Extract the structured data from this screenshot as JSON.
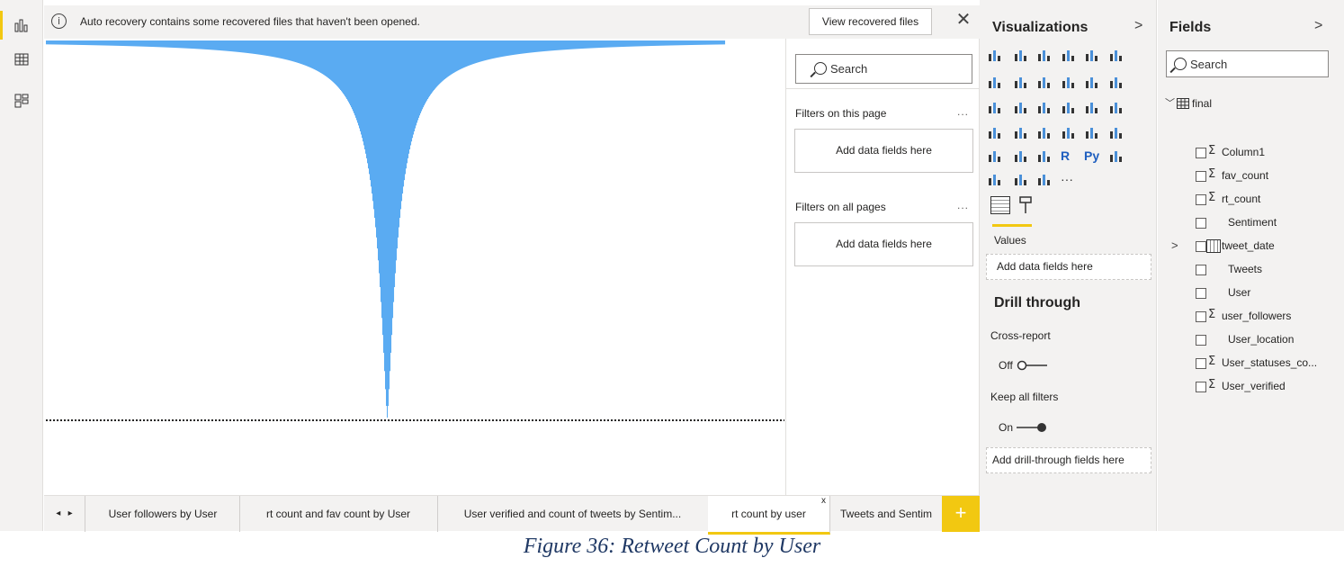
{
  "infobar": {
    "message": "Auto recovery contains some recovered files that haven't been opened.",
    "info_glyph": "i",
    "view_button": "View recovered files",
    "close_glyph": "✕"
  },
  "filters": {
    "search_placeholder": "Search",
    "page_title": "Filters on this page",
    "page_more": "...",
    "page_well": "Add data fields here",
    "all_title": "Filters on all pages",
    "all_more": "...",
    "all_well": "Add data fields here"
  },
  "visualizations": {
    "title": "Visualizations",
    "chevron": ">",
    "icon_R": "R",
    "icon_Py": "Py",
    "icon_more": "···",
    "values_label": "Values",
    "values_well": "Add data fields here",
    "drill_title": "Drill through",
    "cross_report_label": "Cross-report",
    "cross_report_state": "Off",
    "keep_filters_label": "Keep all filters",
    "keep_filters_state": "On",
    "drill_well": "Add drill-through fields here"
  },
  "fields": {
    "title": "Fields",
    "chevron": ">",
    "search_placeholder": "Search",
    "table_name": "final",
    "items": [
      {
        "name": "Column1",
        "sigma": true
      },
      {
        "name": "fav_count",
        "sigma": true
      },
      {
        "name": "rt_count",
        "sigma": true
      },
      {
        "name": "Sentiment",
        "sigma": false
      },
      {
        "name": "tweet_date",
        "sigma": false,
        "date": true
      },
      {
        "name": "Tweets",
        "sigma": false
      },
      {
        "name": "User",
        "sigma": false
      },
      {
        "name": "user_followers",
        "sigma": true
      },
      {
        "name": "User_location",
        "sigma": false
      },
      {
        "name": "User_statuses_co...",
        "sigma": true
      },
      {
        "name": "User_verified",
        "sigma": true
      }
    ]
  },
  "tabs": {
    "nav_prev": "◂",
    "nav_next": "▸",
    "items": [
      "User followers by User",
      "rt count and fav count by User",
      "User verified and count of tweets by Sentim...",
      "rt count by user",
      "Tweets and Sentim"
    ],
    "active_index": 3,
    "active_close": "x",
    "add": "+"
  },
  "caption": "Figure 36: Retweet Count by User",
  "chart_data": {
    "type": "bar",
    "orientation": "vertical-stacked-shape",
    "note_values_from_shape": "many very thin bars, single tall spike in center",
    "values_relative": [
      0.0,
      0.02,
      0.05,
      0.1,
      0.2,
      0.45,
      1.0,
      0.45,
      0.2,
      0.1,
      0.05,
      0.02,
      0.0
    ],
    "title": "",
    "xlabel": "",
    "ylabel": "",
    "color": "#5aabf2",
    "reference_line": "dotted"
  },
  "colors": {
    "accent": "#f2c811",
    "bar": "#5aabf2",
    "panel": "#f3f2f1"
  }
}
